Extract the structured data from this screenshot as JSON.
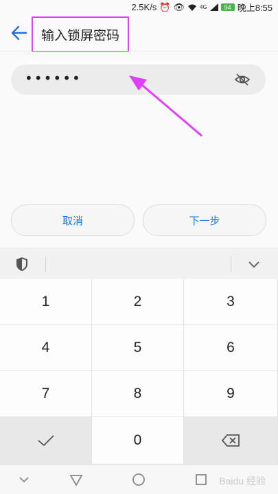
{
  "status_bar": {
    "speed": "2.5K/s",
    "battery": "94",
    "time": "晚上8:55",
    "signal": "4G"
  },
  "header": {
    "title": "输入锁屏密码"
  },
  "password_field": {
    "value": "••••••"
  },
  "buttons": {
    "cancel": "取消",
    "next": "下一步"
  },
  "keypad": {
    "keys": [
      "1",
      "2",
      "3",
      "4",
      "5",
      "6",
      "7",
      "8",
      "9",
      "0"
    ]
  },
  "watermark": "Baidu 经验",
  "colors": {
    "accent": "#1e73d8",
    "annotation": "#e040fb",
    "battery": "#4caf50"
  }
}
